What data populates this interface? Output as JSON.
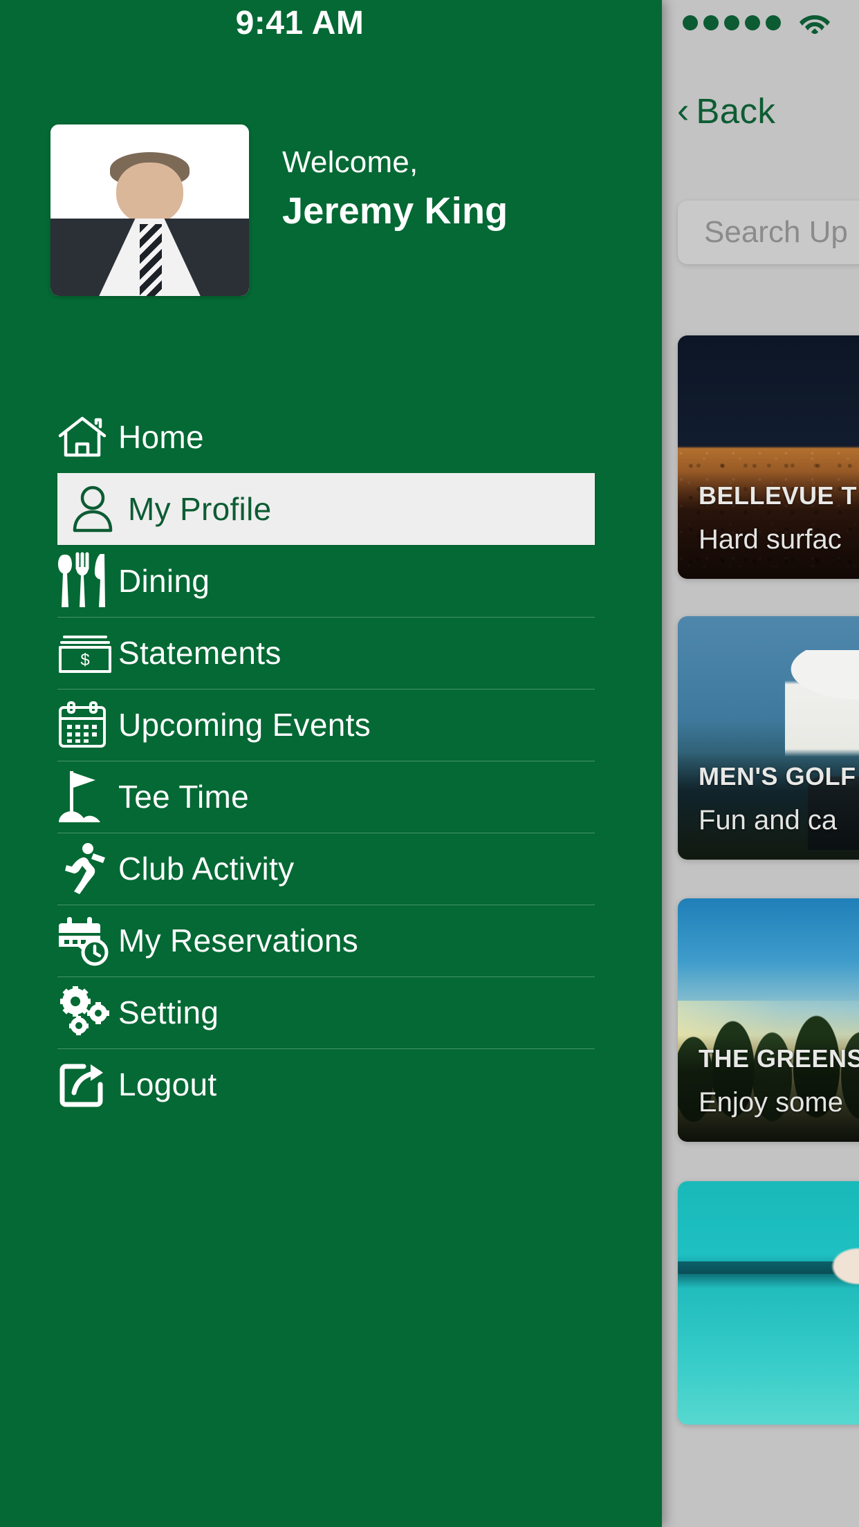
{
  "status_bar": {
    "time": "9:41 AM",
    "signal_dots": 5,
    "wifi_icon": "wifi-icon"
  },
  "drawer": {
    "profile": {
      "greeting": "Welcome,",
      "name": "Jeremy King",
      "avatar": "user-avatar-photo"
    },
    "menu": [
      {
        "label": "Home",
        "icon": "home-icon",
        "active": false
      },
      {
        "label": "My Profile",
        "icon": "person-icon",
        "active": true
      },
      {
        "label": "Dining",
        "icon": "cutlery-icon",
        "active": false
      },
      {
        "label": "Statements",
        "icon": "cash-dollar-icon",
        "active": false
      },
      {
        "label": "Upcoming Events",
        "icon": "calendar-icon",
        "active": false
      },
      {
        "label": "Tee Time",
        "icon": "golf-flag-icon",
        "active": false
      },
      {
        "label": "Club Activity",
        "icon": "runner-icon",
        "active": false
      },
      {
        "label": "My Reservations",
        "icon": "calendar-clock-icon",
        "active": false
      },
      {
        "label": "Setting",
        "icon": "gears-icon",
        "active": false
      },
      {
        "label": "Logout",
        "icon": "logout-share-icon",
        "active": false
      }
    ]
  },
  "content": {
    "back_button": {
      "label": "Back",
      "icon": "chevron-left-icon"
    },
    "search": {
      "placeholder": "Search Up",
      "icon": "search-input"
    },
    "cards": [
      {
        "title": "BELLEVUE T",
        "subtitle": "Hard surfac",
        "art": "art-tennis"
      },
      {
        "title": "MEN'S GOLF",
        "subtitle": "Fun and ca",
        "art": "art-golf"
      },
      {
        "title": "THE GREENS",
        "subtitle": "Enjoy some",
        "art": "art-trees"
      },
      {
        "title": "",
        "subtitle": "",
        "art": "art-pool"
      }
    ]
  },
  "colors": {
    "brand_green": "#046934",
    "dark_green": "#0d5c33",
    "panel_gray": "#c3c3c3",
    "active_bg": "#eeeeee"
  }
}
